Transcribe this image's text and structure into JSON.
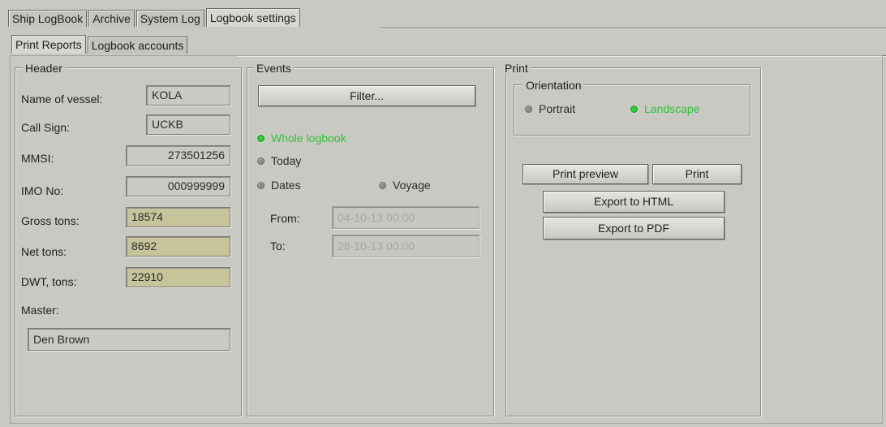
{
  "tabs": [
    "Ship LogBook",
    "Archive",
    "System Log",
    "Logbook settings"
  ],
  "subtabs": [
    "Print Reports",
    "Logbook accounts"
  ],
  "header": {
    "legend": "Header",
    "name_label": "Name of vessel:",
    "name_value": "KOLA",
    "call_label": "Call Sign:",
    "call_value": "UCKB",
    "mmsi_label": "MMSI:",
    "mmsi_value": "273501256",
    "imo_label": "IMO No:",
    "imo_value": "000999999",
    "gross_label": "Gross tons:",
    "gross_value": "18574",
    "net_label": "Net tons:",
    "net_value": "8692",
    "dwt_label": "DWT, tons:",
    "dwt_value": "22910",
    "master_label": "Master:",
    "master_value": "Den Brown"
  },
  "events": {
    "legend": "Events",
    "filter_label": "Filter...",
    "whole": "Whole logbook",
    "today": "Today",
    "dates": "Dates",
    "voyage": "Voyage",
    "from_label": "From:",
    "from_value": "04-10-13 00:00",
    "to_label": "To:",
    "to_value": "28-10-13 00:00"
  },
  "print": {
    "legend": "Print",
    "orientation_legend": "Orientation",
    "portrait": "Portrait",
    "landscape": "Landscape",
    "preview_label": "Print preview",
    "print_label": "Print",
    "html_label": "Export to HTML",
    "pdf_label": "Export to PDF"
  },
  "colors": {
    "active_radio": "#33c23a",
    "highlight_field": "#c5c49a"
  }
}
